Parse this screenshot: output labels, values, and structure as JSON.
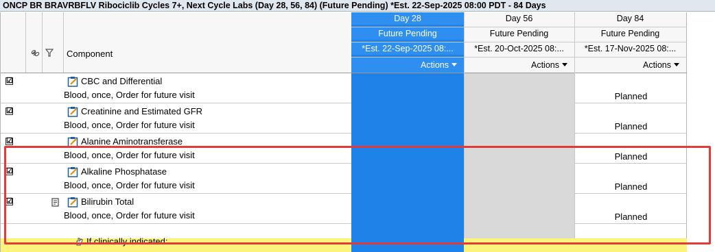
{
  "title": "ONCP BR BRAVRBFLV Ribociclib Cycles 7+, Next Cycle Labs (Day 28, 56, 84) (Future Pending) *Est. 22-Sep-2025 08:00 PDT - 84 Days",
  "header": {
    "component_label": "Component",
    "columns": [
      {
        "day": "Day 28",
        "status": "Future Pending",
        "est": "*Est. 22-Sep-2025 08:...",
        "actions": "Actions"
      },
      {
        "day": "Day 56",
        "status": "Future Pending",
        "est": "*Est. 20-Oct-2025 08:...",
        "actions": "Actions"
      },
      {
        "day": "Day 84",
        "status": "Future Pending",
        "est": "*Est. 17-Nov-2025 08:...",
        "actions": "Actions"
      }
    ]
  },
  "rows": [
    {
      "name": "CBC and Differential",
      "detail": "Blood, once, Order for future visit",
      "checked": "☑",
      "day84": "Planned"
    },
    {
      "name": "Creatinine and Estimated GFR",
      "detail": "Blood, once, Order for future visit",
      "checked": "☑",
      "day84": "Planned"
    },
    {
      "name": "Alanine Aminotransferase",
      "detail": "Blood, once, Order for future visit",
      "checked": "☑",
      "day84": "Planned"
    },
    {
      "name": "Alkaline Phosphatase",
      "detail": "Blood, once, Order for future visit",
      "checked": "☑",
      "day84": "Planned"
    },
    {
      "name": "Bilirubin Total",
      "detail": "Blood, once, Order for future visit",
      "checked": "☑",
      "day84": "Planned"
    }
  ],
  "footer_row": {
    "text": "If clinically indicated:"
  },
  "colors": {
    "day28": "#1d83e8",
    "day56": "#d9d9d9",
    "highlight": "#e23a3a",
    "footer": "#fcf47a"
  },
  "icons": {
    "link": "link-icon",
    "filter": "filter-icon",
    "order": "order-clipboard-icon",
    "document": "document-icon"
  }
}
